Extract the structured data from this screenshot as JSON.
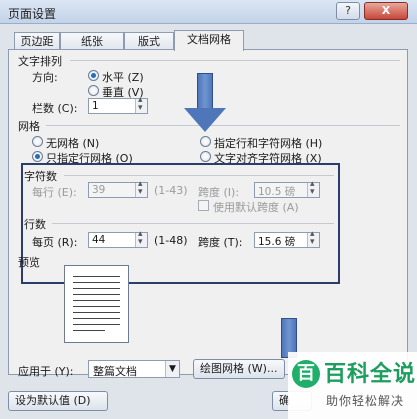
{
  "window": {
    "title": "页面设置",
    "help_label": "?",
    "close_label": "X"
  },
  "tabs": [
    {
      "label": "页边距"
    },
    {
      "label": "纸张"
    },
    {
      "label": "版式"
    },
    {
      "label": "文档网格"
    }
  ],
  "text_direction": {
    "section_label": "文字排列",
    "direction_label": "方向:",
    "horizontal_label": "水平 (Z)",
    "vertical_label": "垂直 (V)",
    "columns_label": "栏数 (C):",
    "columns_value": "1"
  },
  "grid": {
    "section_label": "网格",
    "no_grid_label": "无网格 (N)",
    "line_grid_label": "只指定行网格 (O)",
    "line_char_grid_label": "指定行和字符网格 (H)",
    "text_snap_label": "文字对齐字符网格 (X)"
  },
  "characters": {
    "section_label": "字符数",
    "per_line_label": "每行 (E):",
    "per_line_value": "39",
    "per_line_range": "(1-43)",
    "pitch_label": "跨度 (I):",
    "pitch_value": "10.5 磅",
    "default_pitch_label": "使用默认跨度 (A)"
  },
  "lines": {
    "section_label": "行数",
    "per_page_label": "每页 (R):",
    "per_page_value": "44",
    "per_page_range": "(1-48)",
    "pitch_label": "跨度 (T):",
    "pitch_value": "15.6 磅"
  },
  "preview": {
    "section_label": "预览"
  },
  "footer": {
    "apply_to_label": "应用于 (Y):",
    "apply_to_value": "整篇文档",
    "drawing_grid_label": "绘图网格 (W)...",
    "set_default_label": "设为默认值 (D)",
    "ok_label": "确"
  },
  "watermark": {
    "logo": "百",
    "title": "百科全说",
    "subtitle": "助你轻松解决"
  },
  "colors": {
    "arrow": "#4f76b8",
    "highlight_box": "#2a3d6b",
    "watermark_green": "#1c9e5e"
  }
}
